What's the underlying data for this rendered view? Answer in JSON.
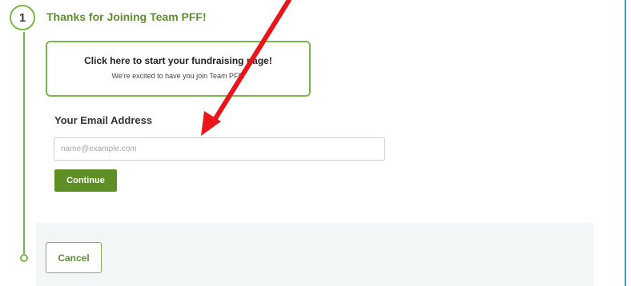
{
  "step": {
    "number": "1",
    "title": "Thanks for Joining Team PFF!"
  },
  "fundraise_card": {
    "title": "Click here to start your fundraising page!",
    "subtitle": "We're excited to have you join Team PFF!"
  },
  "email_form": {
    "label": "Your Email Address",
    "placeholder": "name@example.com",
    "value": "",
    "continue_label": "Continue"
  },
  "footer": {
    "cancel_label": "Cancel"
  },
  "colors": {
    "accent_green": "#7ab648",
    "button_green": "#5e8f24",
    "annotation_red": "#e8151b",
    "panel_border_blue": "#4a9bb8"
  },
  "icons": {
    "annotation": "red-arrow-icon"
  }
}
